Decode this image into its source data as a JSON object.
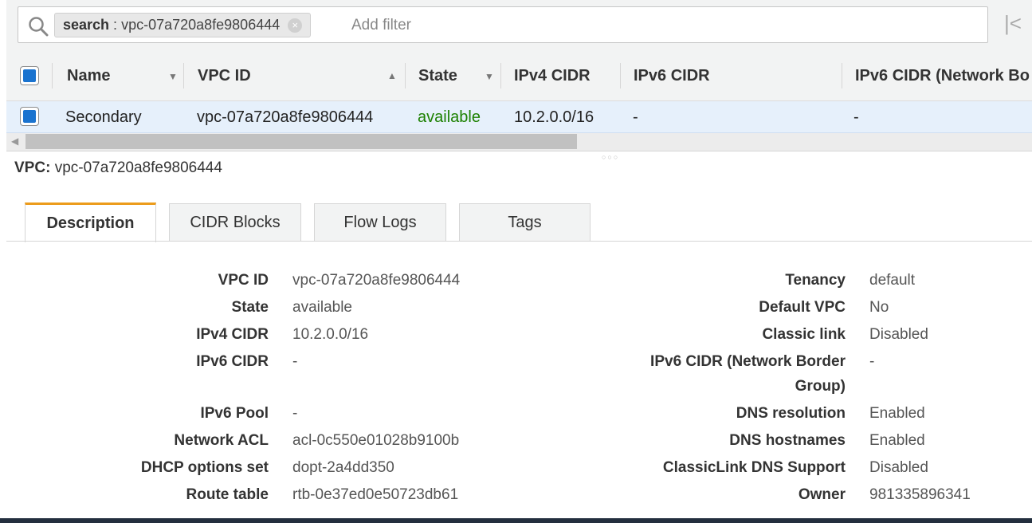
{
  "search": {
    "token_key": "search",
    "token_sep": ":",
    "token_value": "vpc-07a720a8fe9806444",
    "placeholder": "Add filter"
  },
  "table": {
    "columns": [
      "Name",
      "VPC ID",
      "State",
      "IPv4 CIDR",
      "IPv6 CIDR",
      "IPv6 CIDR (Network Bo"
    ],
    "row": {
      "name": "Secondary",
      "vpc_id": "vpc-07a720a8fe9806444",
      "state": "available",
      "ipv4": "10.2.0.0/16",
      "ipv6": "-",
      "ipv6_nbg": "-"
    }
  },
  "detail": {
    "title_label": "VPC:",
    "title_value": "vpc-07a720a8fe9806444",
    "tabs": [
      "Description",
      "CIDR Blocks",
      "Flow Logs",
      "Tags"
    ],
    "left": [
      {
        "label": "VPC ID",
        "value": "vpc-07a720a8fe9806444"
      },
      {
        "label": "State",
        "value": "available"
      },
      {
        "label": "IPv4 CIDR",
        "value": "10.2.0.0/16"
      },
      {
        "label": "IPv6 CIDR",
        "value": "-"
      },
      {
        "label": "IPv6 Pool",
        "value": "-"
      },
      {
        "label": "Network ACL",
        "value": "acl-0c550e01028b9100b"
      },
      {
        "label": "DHCP options set",
        "value": "dopt-2a4dd350"
      },
      {
        "label": "Route table",
        "value": "rtb-0e37ed0e50723db61"
      }
    ],
    "right": [
      {
        "label": "Tenancy",
        "value": "default"
      },
      {
        "label": "Default VPC",
        "value": "No"
      },
      {
        "label": "Classic link",
        "value": "Disabled"
      },
      {
        "label": "IPv6 CIDR (Network Border",
        "label2": "Group)",
        "value": "-"
      },
      {
        "label": "DNS resolution",
        "value": "Enabled"
      },
      {
        "label": "DNS hostnames",
        "value": "Enabled"
      },
      {
        "label": "ClassicLink DNS Support",
        "value": "Disabled"
      },
      {
        "label": "Owner",
        "value": "981335896341"
      }
    ]
  },
  "colors": {
    "status_green": "#1d8102",
    "link_blue": "#1f6fb5",
    "active_tab_accent": "#ec9c1c",
    "selected_row": "#e6f0fb"
  }
}
